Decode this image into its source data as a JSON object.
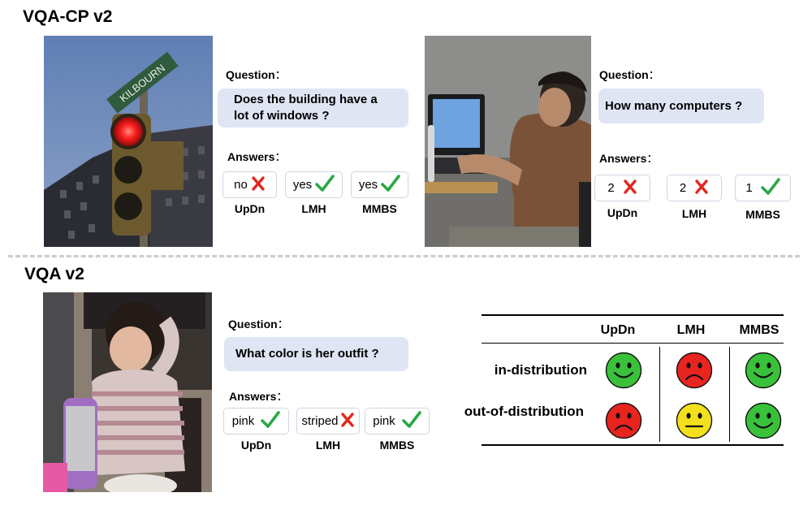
{
  "top_section": {
    "title": "VQA-CP v2",
    "examples": [
      {
        "question_label": "Question",
        "question": "Does the building have a lot of windows ?",
        "answers_label": "Answers",
        "answers": [
          {
            "model": "UpDn",
            "answer": "no",
            "correct": false
          },
          {
            "model": "LMH",
            "answer": "yes",
            "correct": true
          },
          {
            "model": "MMBS",
            "answer": "yes",
            "correct": true
          }
        ],
        "street_sign_text": "KILBOURN"
      },
      {
        "question_label": "Question",
        "question": "How many computers ?",
        "answers_label": "Answers",
        "answers": [
          {
            "model": "UpDn",
            "answer": "2",
            "correct": false
          },
          {
            "model": "LMH",
            "answer": "2",
            "correct": false
          },
          {
            "model": "MMBS",
            "answer": "1",
            "correct": true
          }
        ]
      }
    ]
  },
  "bottom_section": {
    "title": "VQA v2",
    "example": {
      "question_label": "Question",
      "question": "What color is her outfit ?",
      "answers_label": "Answers",
      "answers": [
        {
          "model": "UpDn",
          "answer": "pink",
          "correct": true
        },
        {
          "model": "LMH",
          "answer": "striped",
          "correct": false
        },
        {
          "model": "MMBS",
          "answer": "pink",
          "correct": true
        }
      ]
    },
    "table": {
      "columns": [
        "UpDn",
        "LMH",
        "MMBS"
      ],
      "rows": [
        {
          "label": "in-distribution",
          "faces": [
            "happy",
            "sad",
            "happy"
          ]
        },
        {
          "label": "out-of-distribution",
          "faces": [
            "sad",
            "neutral",
            "happy"
          ]
        }
      ]
    }
  },
  "colon": "：",
  "colors": {
    "check": "#2aa845",
    "cross": "#e0281f",
    "happy_face": "#3ac13a",
    "sad_face": "#e8241e",
    "neutral_face": "#f2e01c",
    "bubble": "#dfe5f3"
  }
}
